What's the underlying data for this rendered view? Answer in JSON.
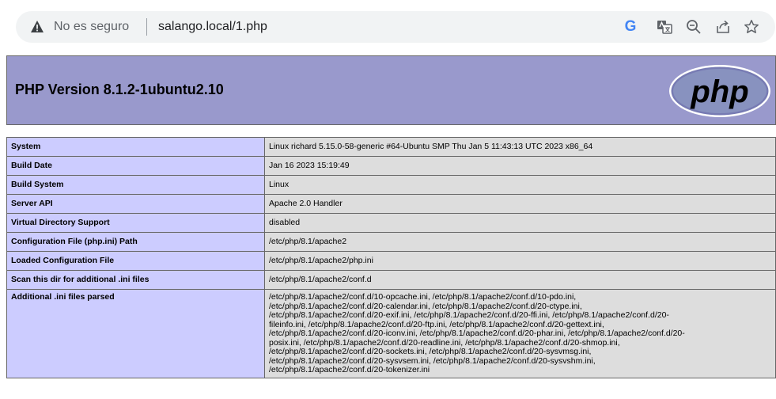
{
  "browser": {
    "security_label": "No es seguro",
    "url": "salango.local/1.php",
    "toolbar_icons": [
      "google-icon",
      "translate-icon",
      "zoom-out-icon",
      "share-icon",
      "bookmark-star-icon"
    ],
    "google_letter": "G"
  },
  "header": {
    "title": "PHP Version 8.1.2-1ubuntu2.10",
    "logo_text": "php"
  },
  "colors": {
    "header_bg": "#9999cc",
    "key_cell_bg": "#ccccff",
    "value_cell_bg": "#dddddd",
    "border": "#666666"
  },
  "rows": [
    {
      "key": "System",
      "value": "Linux richard 5.15.0-58-generic #64-Ubuntu SMP Thu Jan 5 11:43:13 UTC 2023 x86_64"
    },
    {
      "key": "Build Date",
      "value": "Jan 16 2023 15:19:49"
    },
    {
      "key": "Build System",
      "value": "Linux"
    },
    {
      "key": "Server API",
      "value": "Apache 2.0 Handler"
    },
    {
      "key": "Virtual Directory Support",
      "value": "disabled"
    },
    {
      "key": "Configuration File (php.ini) Path",
      "value": "/etc/php/8.1/apache2"
    },
    {
      "key": "Loaded Configuration File",
      "value": "/etc/php/8.1/apache2/php.ini"
    },
    {
      "key": "Scan this dir for additional .ini files",
      "value": "/etc/php/8.1/apache2/conf.d"
    },
    {
      "key": "Additional .ini files parsed",
      "value_lines": [
        "/etc/php/8.1/apache2/conf.d/10-opcache.ini, /etc/php/8.1/apache2/conf.d/10-pdo.ini,",
        "/etc/php/8.1/apache2/conf.d/20-calendar.ini, /etc/php/8.1/apache2/conf.d/20-ctype.ini,",
        "/etc/php/8.1/apache2/conf.d/20-exif.ini, /etc/php/8.1/apache2/conf.d/20-ffi.ini, /etc/php/8.1/apache2/conf.d/20-",
        "fileinfo.ini, /etc/php/8.1/apache2/conf.d/20-ftp.ini, /etc/php/8.1/apache2/conf.d/20-gettext.ini,",
        "/etc/php/8.1/apache2/conf.d/20-iconv.ini, /etc/php/8.1/apache2/conf.d/20-phar.ini, /etc/php/8.1/apache2/conf.d/20-",
        "posix.ini, /etc/php/8.1/apache2/conf.d/20-readline.ini, /etc/php/8.1/apache2/conf.d/20-shmop.ini,",
        "/etc/php/8.1/apache2/conf.d/20-sockets.ini, /etc/php/8.1/apache2/conf.d/20-sysvmsg.ini,",
        "/etc/php/8.1/apache2/conf.d/20-sysvsem.ini, /etc/php/8.1/apache2/conf.d/20-sysvshm.ini,",
        "/etc/php/8.1/apache2/conf.d/20-tokenizer.ini"
      ]
    }
  ]
}
